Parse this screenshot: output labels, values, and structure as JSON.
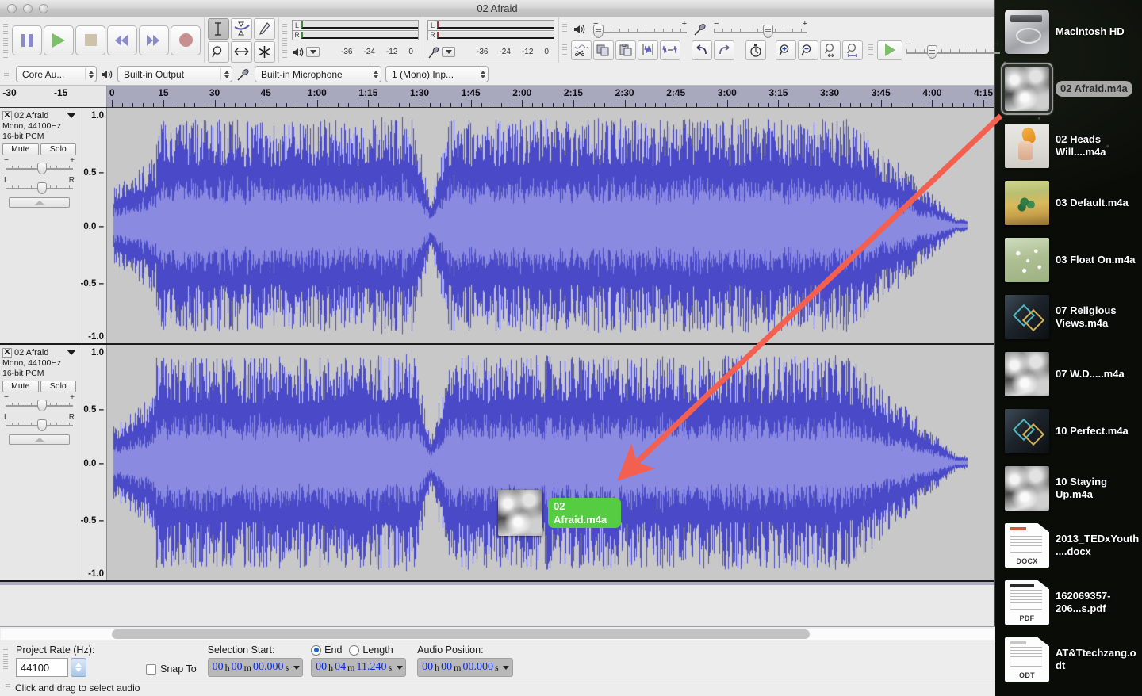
{
  "window": {
    "title": "02 Afraid",
    "controls": [
      "close",
      "minimize",
      "zoom"
    ]
  },
  "transport": {
    "buttons": [
      {
        "name": "pause",
        "label": "Pause"
      },
      {
        "name": "play",
        "label": "Play"
      },
      {
        "name": "stop",
        "label": "Stop"
      },
      {
        "name": "skip-start",
        "label": "Skip to Start"
      },
      {
        "name": "skip-end",
        "label": "Skip to End"
      },
      {
        "name": "record",
        "label": "Record"
      }
    ]
  },
  "tools": {
    "items": [
      {
        "name": "selection-tool",
        "glyph": "I",
        "selected": true
      },
      {
        "name": "envelope-tool",
        "glyph": "envelope",
        "selected": false
      },
      {
        "name": "draw-tool",
        "glyph": "pencil",
        "selected": false
      },
      {
        "name": "zoom-tool",
        "glyph": "magnifier",
        "selected": false
      },
      {
        "name": "time-shift-tool",
        "glyph": "arrows",
        "selected": false
      },
      {
        "name": "multi-tool",
        "glyph": "asterisk",
        "selected": false
      }
    ]
  },
  "meters": {
    "playback": {
      "channels": [
        "L",
        "R"
      ],
      "scale": [
        "-36",
        "-24",
        "-12",
        "0"
      ]
    },
    "recording": {
      "channels": [
        "L",
        "R"
      ],
      "scale": [
        "-36",
        "-24",
        "-12",
        "0"
      ]
    }
  },
  "mixer": {
    "output_minus": "−",
    "output_plus": "+",
    "input_minus": "−",
    "input_plus": "+"
  },
  "edit_toolbar": {
    "buttons": [
      {
        "name": "cut-button",
        "label": "Cut"
      },
      {
        "name": "copy-button",
        "label": "Copy"
      },
      {
        "name": "paste-button",
        "label": "Paste"
      },
      {
        "name": "trim-outside-selection-button",
        "label": "Trim"
      },
      {
        "name": "silence-audio-button",
        "label": "Silence"
      },
      {
        "name": "undo-button",
        "label": "Undo"
      },
      {
        "name": "redo-button",
        "label": "Redo"
      },
      {
        "name": "sync-lock-button",
        "label": "Sync-Lock"
      },
      {
        "name": "zoom-in-button",
        "label": "Zoom In"
      },
      {
        "name": "zoom-out-button",
        "label": "Zoom Out"
      },
      {
        "name": "fit-selection-button",
        "label": "Fit Selection"
      },
      {
        "name": "fit-project-button",
        "label": "Fit Project"
      }
    ]
  },
  "play_at_speed": {
    "label": "Play-at-Speed",
    "minus": "−",
    "plus": "+"
  },
  "device_toolbar": {
    "host": "Core Au...",
    "output_device": "Built-in Output",
    "input_device": "Built-in Microphone",
    "input_channels": "1 (Mono) Inp..."
  },
  "ruler": {
    "labels": [
      "-30",
      "-15",
      "0",
      "15",
      "30",
      "45",
      "1:00",
      "1:15",
      "1:30",
      "1:45",
      "2:00",
      "2:15",
      "2:30",
      "2:45",
      "3:00",
      "3:15",
      "3:30",
      "3:45",
      "4:00",
      "4:15"
    ]
  },
  "tracks": [
    {
      "name": "02 Afraid",
      "format": "Mono, 44100Hz",
      "depth": "16-bit PCM",
      "mute_label": "Mute",
      "solo_label": "Solo",
      "gain_minus": "−",
      "gain_plus": "+",
      "pan_left": "L",
      "pan_right": "R",
      "vertical_scale": [
        "1.0",
        "0.5",
        "0.0",
        "-0.5",
        "-1.0"
      ]
    },
    {
      "name": "02 Afraid",
      "format": "Mono, 44100Hz",
      "depth": "16-bit PCM",
      "mute_label": "Mute",
      "solo_label": "Solo",
      "gain_minus": "−",
      "gain_plus": "+",
      "pan_left": "L",
      "pan_right": "R",
      "vertical_scale": [
        "1.0",
        "0.5",
        "0.0",
        "-0.5",
        "-1.0"
      ]
    }
  ],
  "selection_bar": {
    "project_rate_label": "Project Rate (Hz):",
    "project_rate_value": "44100",
    "snap_to_label": "Snap To",
    "snap_to_checked": false,
    "selection_start_label": "Selection Start:",
    "end_label": "End",
    "length_label": "Length",
    "end_selected": true,
    "audio_position_label": "Audio Position:",
    "selection_start_value": {
      "h": "00",
      "m": "00",
      "s": "00.000"
    },
    "selection_end_value": {
      "h": "00",
      "m": "04",
      "s": "11.240"
    },
    "audio_position_value": {
      "h": "00",
      "m": "00",
      "s": "00.000"
    },
    "unit_h": "h",
    "unit_m": "m",
    "unit_s": "s"
  },
  "status_bar": {
    "message": "Click and drag to select audio"
  },
  "drag_ghost": {
    "label": "02 Afraid.m4a"
  },
  "annotation": {
    "arrow_color": "#f4604f"
  },
  "desktop_icons": [
    {
      "label": "Macintosh HD",
      "art": "art-hd",
      "selected": false,
      "kind": ""
    },
    {
      "label": "02 Afraid.m4a",
      "art": "art-cloud",
      "selected": true,
      "kind": ""
    },
    {
      "label": "02 Heads Will....m4a",
      "art": "art-hand",
      "selected": false,
      "kind": ""
    },
    {
      "label": "03 Default.m4a",
      "art": "art-desert",
      "selected": false,
      "kind": ""
    },
    {
      "label": "03 Float On.m4a",
      "art": "art-float",
      "selected": false,
      "kind": ""
    },
    {
      "label": "07 Religious Views.m4a",
      "art": "art-just",
      "selected": false,
      "kind": ""
    },
    {
      "label": "07 W.D.....m4a",
      "art": "art-cloud",
      "selected": false,
      "kind": ""
    },
    {
      "label": "10 Perfect.m4a",
      "art": "art-just",
      "selected": false,
      "kind": ""
    },
    {
      "label": "10 Staying Up.m4a",
      "art": "art-cloud",
      "selected": false,
      "kind": ""
    },
    {
      "label": "2013_TEDxYouth....docx",
      "art": "art-doc",
      "selected": false,
      "kind": "DOCX"
    },
    {
      "label": "162069357-206...s.pdf",
      "art": "art-doc pdf",
      "selected": false,
      "kind": "PDF"
    },
    {
      "label": "AT&Ttechzang.odt",
      "art": "art-doc odt",
      "selected": false,
      "kind": "ODT"
    }
  ],
  "colors": {
    "waveform_peak": "#4a4ac8",
    "waveform_rms": "#8a8ae0",
    "track_bg": "#c8c8c8",
    "ruler_bg": "#a9a9bd",
    "selection_green": "#56cc42"
  }
}
